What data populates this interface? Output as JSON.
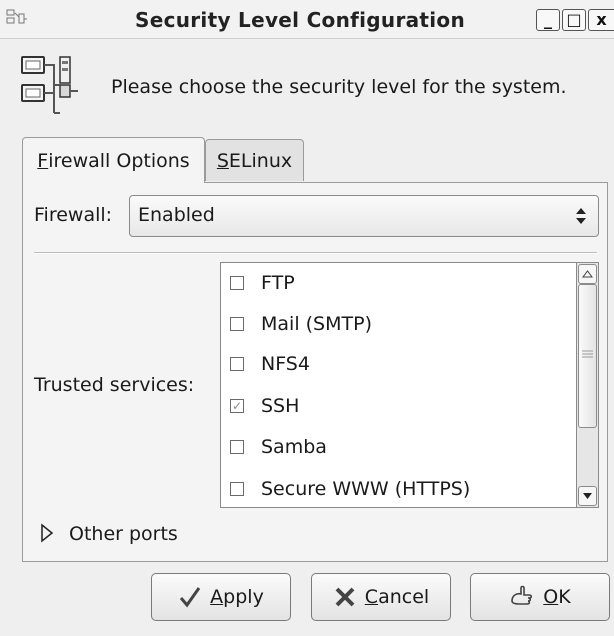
{
  "window": {
    "title": "Security Level Configuration",
    "controls": {
      "minimize": "_",
      "maximize": "□",
      "close": "x"
    }
  },
  "header": {
    "text": "Please choose the security level for the system.",
    "icon": "network-computers-icon"
  },
  "tabs": [
    {
      "label_mnemonic": "F",
      "label_rest": "irewall Options",
      "selected": true
    },
    {
      "label_mnemonic": "S",
      "label_rest": "ELinux",
      "selected": false
    }
  ],
  "firewall": {
    "label": "Firewall:",
    "value": "Enabled"
  },
  "trusted_services": {
    "label": "Trusted services:",
    "items": [
      {
        "label": "FTP",
        "checked": false
      },
      {
        "label": "Mail (SMTP)",
        "checked": false
      },
      {
        "label": "NFS4",
        "checked": false
      },
      {
        "label": "SSH",
        "checked": true
      },
      {
        "label": "Samba",
        "checked": false
      },
      {
        "label": "Secure WWW (HTTPS)",
        "checked": false
      }
    ]
  },
  "other_ports": {
    "label": "Other ports",
    "expanded": false
  },
  "buttons": {
    "apply": {
      "mnemonic": "A",
      "rest": "pply",
      "icon": "checkmark-icon"
    },
    "cancel": {
      "mnemonic": "C",
      "rest": "ancel",
      "icon": "x-icon"
    },
    "ok": {
      "mnemonic": "O",
      "rest": "K",
      "icon": "ok-hand-icon"
    }
  },
  "colors": {
    "window_bg": "#efefef",
    "list_bg": "#ffffff",
    "border": "#8a8a8a"
  }
}
